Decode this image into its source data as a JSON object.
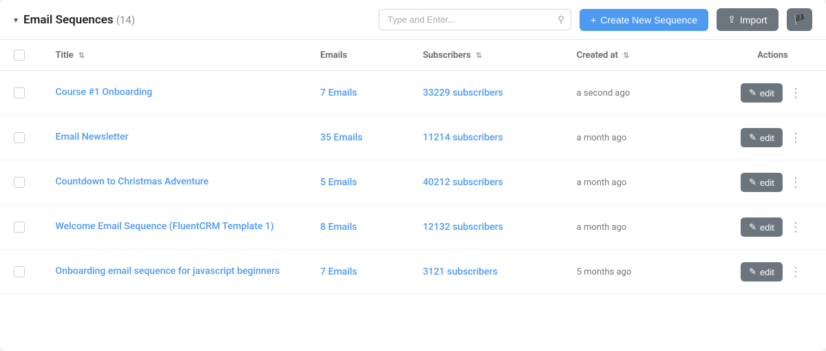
{
  "header": {
    "title": "Email Sequences",
    "count": "(14)",
    "search_placeholder": "Type and Enter...",
    "create_label": "Create New Sequence",
    "import_label": "Import"
  },
  "table": {
    "columns": {
      "title": "Title",
      "emails": "Emails",
      "subscribers": "Subscribers",
      "created_at": "Created at",
      "actions": "Actions"
    },
    "rows": [
      {
        "title": "Course #1 Onboarding",
        "emails": "7 Emails",
        "subscribers": "33229 subscribers",
        "created_at": "a second ago",
        "edit_label": "edit"
      },
      {
        "title": "Email Newsletter",
        "emails": "35 Emails",
        "subscribers": "11214 subscribers",
        "created_at": "a month ago",
        "edit_label": "edit"
      },
      {
        "title": "Countdown to Christmas Adventure",
        "emails": "5 Emails",
        "subscribers": "40212 subscribers",
        "created_at": "a month ago",
        "edit_label": "edit"
      },
      {
        "title": "Welcome Email Sequence (FluentCRM Template 1)",
        "emails": "8 Emails",
        "subscribers": "12132 subscribers",
        "created_at": "a month ago",
        "edit_label": "edit"
      },
      {
        "title": "Onboarding email sequence for javascript beginners",
        "emails": "7 Emails",
        "subscribers": "3121 subscribers",
        "created_at": "5 months ago",
        "edit_label": "edit"
      }
    ]
  }
}
